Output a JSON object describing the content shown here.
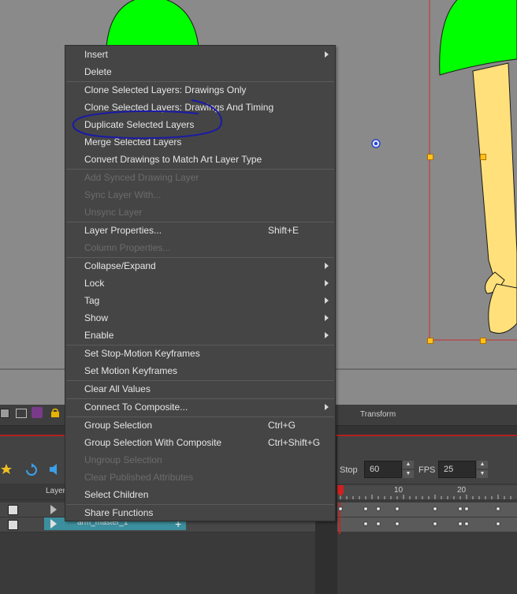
{
  "context_menu": {
    "items": [
      {
        "label": "Insert",
        "enabled": true,
        "submenu": true
      },
      {
        "label": "Delete",
        "enabled": true
      },
      {
        "label": "Clone Selected Layers: Drawings Only",
        "enabled": true
      },
      {
        "label": "Clone Selected Layers: Drawings And Timing",
        "enabled": true
      },
      {
        "label": "Duplicate Selected Layers",
        "enabled": true,
        "circled": true
      },
      {
        "label": "Merge Selected Layers",
        "enabled": true
      },
      {
        "label": "Convert Drawings to Match Art Layer Type",
        "enabled": true
      },
      {
        "label": "Add Synced Drawing Layer",
        "enabled": false
      },
      {
        "label": "Sync Layer With...",
        "enabled": false
      },
      {
        "label": "Unsync Layer",
        "enabled": false
      },
      {
        "label": "Layer Properties...",
        "enabled": true,
        "shortcut": "Shift+E"
      },
      {
        "label": "Column Properties...",
        "enabled": false
      },
      {
        "label": "Collapse/Expand",
        "enabled": true,
        "submenu": true
      },
      {
        "label": "Lock",
        "enabled": true,
        "submenu": true
      },
      {
        "label": "Tag",
        "enabled": true,
        "submenu": true
      },
      {
        "label": "Show",
        "enabled": true,
        "submenu": true
      },
      {
        "label": "Enable",
        "enabled": true,
        "submenu": true
      },
      {
        "label": "Set Stop-Motion Keyframes",
        "enabled": true
      },
      {
        "label": "Set Motion Keyframes",
        "enabled": true
      },
      {
        "label": "Clear All Values",
        "enabled": true
      },
      {
        "label": "Connect To Composite...",
        "enabled": true,
        "submenu": true
      },
      {
        "label": "Group Selection",
        "enabled": true,
        "shortcut": "Ctrl+G"
      },
      {
        "label": "Group Selection With Composite",
        "enabled": true,
        "shortcut": "Ctrl+Shift+G"
      },
      {
        "label": "Ungroup Selection",
        "enabled": false
      },
      {
        "label": "Clear Published Attributes",
        "enabled": false
      },
      {
        "label": "Select Children",
        "enabled": true
      },
      {
        "label": "Share Functions",
        "enabled": true
      }
    ]
  },
  "toolbar": {
    "panel_label": "Transform"
  },
  "playback": {
    "stop_label": "Stop",
    "stop_value": "60",
    "fps_label": "FPS",
    "fps_value": "25"
  },
  "timeline": {
    "ruler_labels": [
      "10",
      "20"
    ],
    "layers_header": "Layer",
    "selected_layer": "arm_master_1"
  },
  "colors": {
    "menu_bg": "#454545",
    "canvas_bg": "#8a8a8a",
    "mushroom_cap": "#00ff00",
    "stem": "#ffe07a",
    "bbox_red": "#c83030",
    "annotation_blue": "#1a1aa8",
    "selected_layer": "#3c8f9e"
  }
}
